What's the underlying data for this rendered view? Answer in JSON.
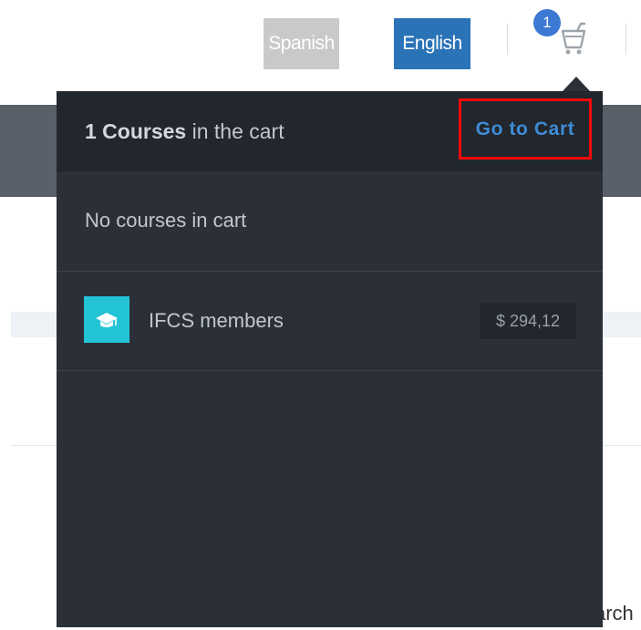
{
  "header": {
    "languages": [
      {
        "label": "Spanish",
        "active": false
      },
      {
        "label": "English",
        "active": true
      }
    ],
    "cart_count": "1"
  },
  "cart_dropdown": {
    "title_count": "1 Courses",
    "title_suffix": " in the cart",
    "go_to_cart_label": "Go to Cart",
    "empty_message": "No courses in cart",
    "items": [
      {
        "name": "IFCS members",
        "price": "$ 294,12",
        "icon": "graduation-cap-icon"
      }
    ]
  },
  "background": {
    "partial_text": "arch"
  },
  "colors": {
    "accent": "#2a73b7",
    "badge": "#3b79d2",
    "dropdown_bg": "#2b3038",
    "highlight_box": "#f20a0a",
    "item_thumb": "#23c4d6"
  }
}
